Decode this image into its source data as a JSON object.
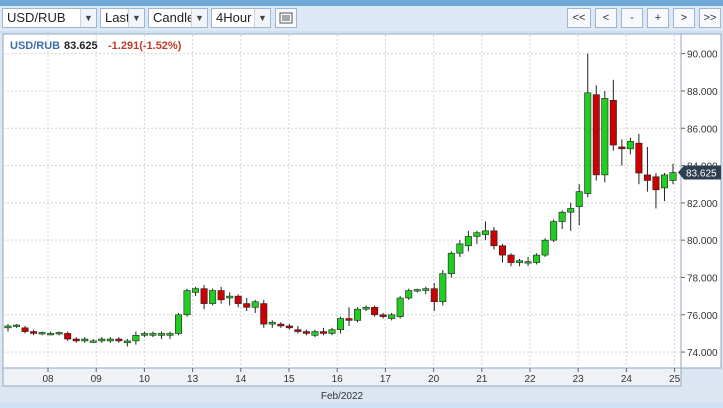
{
  "toolbar": {
    "symbol": "USD/RUB",
    "price_type": "Last",
    "chart_style": "Candle",
    "interval": "4Hour",
    "nav": [
      "<<",
      "<",
      "-",
      "+",
      ">",
      ">>"
    ],
    "list_icon": "list-icon",
    "dropdown_icon": "chevron-down-icon"
  },
  "header": {
    "symbol": "USD/RUB",
    "price": "83.625",
    "change": "-1.291(-1.52%)"
  },
  "colors": {
    "up": "#22cc22",
    "down": "#cc0000",
    "symbol": "#3a6ea5",
    "change": "#c0392b",
    "badge": "#2d3e50"
  },
  "chart_data": {
    "type": "candlestick",
    "x_label": "Feb/2022",
    "x_ticks": [
      "08",
      "09",
      "10",
      "13",
      "14",
      "15",
      "16",
      "17",
      "20",
      "21",
      "22",
      "23",
      "24",
      "25"
    ],
    "y_ticks": [
      "74.000",
      "76.000",
      "78.000",
      "80.000",
      "82.000",
      "84.000",
      "86.000",
      "88.000",
      "90.000"
    ],
    "ylim": [
      73.2,
      91.0
    ],
    "last_price": "83.625",
    "candles": [
      [
        75.3,
        75.5,
        75.1,
        75.4
      ],
      [
        75.4,
        75.5,
        75.3,
        75.45
      ],
      [
        75.3,
        75.4,
        75.0,
        75.1
      ],
      [
        75.1,
        75.2,
        74.9,
        75.0
      ],
      [
        75.0,
        75.1,
        74.9,
        75.05
      ],
      [
        75.0,
        75.1,
        74.9,
        75.0
      ],
      [
        75.0,
        75.1,
        74.9,
        75.05
      ],
      [
        75.0,
        75.1,
        74.6,
        74.7
      ],
      [
        74.7,
        74.8,
        74.5,
        74.6
      ],
      [
        74.6,
        74.8,
        74.5,
        74.7
      ],
      [
        74.6,
        74.7,
        74.5,
        74.6
      ],
      [
        74.6,
        74.8,
        74.5,
        74.7
      ],
      [
        74.6,
        74.8,
        74.5,
        74.7
      ],
      [
        74.7,
        74.8,
        74.5,
        74.6
      ],
      [
        74.5,
        74.7,
        74.3,
        74.6
      ],
      [
        74.6,
        75.1,
        74.4,
        74.9
      ],
      [
        74.9,
        75.1,
        74.8,
        75.0
      ],
      [
        74.9,
        75.1,
        74.8,
        75.0
      ],
      [
        74.9,
        75.1,
        74.7,
        75.0
      ],
      [
        74.9,
        75.1,
        74.7,
        75.0
      ],
      [
        75.0,
        76.1,
        74.9,
        76.0
      ],
      [
        76.0,
        77.4,
        75.9,
        77.3
      ],
      [
        77.2,
        77.5,
        77.0,
        77.4
      ],
      [
        77.4,
        77.6,
        76.3,
        76.6
      ],
      [
        76.6,
        77.4,
        76.5,
        77.3
      ],
      [
        77.3,
        77.5,
        76.6,
        76.8
      ],
      [
        76.9,
        77.2,
        76.5,
        77.0
      ],
      [
        77.0,
        77.1,
        76.4,
        76.6
      ],
      [
        76.6,
        76.9,
        76.2,
        76.4
      ],
      [
        76.4,
        76.8,
        76.1,
        76.7
      ],
      [
        76.6,
        76.8,
        75.3,
        75.5
      ],
      [
        75.5,
        75.7,
        75.3,
        75.6
      ],
      [
        75.5,
        75.6,
        75.3,
        75.4
      ],
      [
        75.4,
        75.5,
        75.2,
        75.3
      ],
      [
        75.2,
        75.4,
        75.0,
        75.1
      ],
      [
        75.1,
        75.2,
        74.9,
        75.0
      ],
      [
        74.9,
        75.2,
        74.8,
        75.1
      ],
      [
        75.1,
        75.3,
        74.9,
        75.0
      ],
      [
        75.0,
        75.3,
        74.9,
        75.2
      ],
      [
        75.2,
        75.9,
        75.0,
        75.8
      ],
      [
        75.8,
        76.4,
        75.4,
        75.7
      ],
      [
        75.7,
        76.4,
        75.6,
        76.3
      ],
      [
        76.3,
        76.5,
        76.2,
        76.4
      ],
      [
        76.4,
        76.5,
        75.9,
        76.0
      ],
      [
        76.0,
        76.1,
        75.8,
        75.9
      ],
      [
        75.8,
        76.1,
        75.7,
        76.0
      ],
      [
        75.9,
        77.0,
        75.8,
        76.9
      ],
      [
        76.9,
        77.4,
        76.8,
        77.3
      ],
      [
        77.3,
        77.4,
        77.2,
        77.35
      ],
      [
        77.3,
        77.5,
        77.1,
        77.4
      ],
      [
        77.4,
        77.7,
        76.2,
        76.7
      ],
      [
        76.7,
        78.4,
        76.5,
        78.2
      ],
      [
        78.2,
        79.4,
        78.0,
        79.3
      ],
      [
        79.3,
        80.0,
        79.1,
        79.8
      ],
      [
        79.7,
        80.5,
        79.4,
        80.2
      ],
      [
        80.2,
        80.5,
        79.8,
        80.4
      ],
      [
        80.3,
        81.0,
        80.0,
        80.5
      ],
      [
        80.5,
        80.7,
        79.5,
        79.7
      ],
      [
        79.7,
        79.8,
        78.8,
        79.2
      ],
      [
        79.2,
        79.3,
        78.6,
        78.8
      ],
      [
        78.8,
        79.0,
        78.6,
        78.9
      ],
      [
        78.8,
        79.1,
        78.6,
        78.85
      ],
      [
        78.8,
        79.3,
        78.7,
        79.2
      ],
      [
        79.2,
        80.1,
        79.1,
        80.0
      ],
      [
        80.0,
        81.1,
        79.9,
        81.0
      ],
      [
        81.0,
        81.6,
        80.6,
        81.5
      ],
      [
        81.5,
        82.0,
        80.5,
        81.7
      ],
      [
        81.8,
        83.0,
        80.8,
        82.6
      ],
      [
        82.5,
        90.0,
        82.3,
        87.9
      ],
      [
        87.8,
        88.3,
        83.2,
        83.5
      ],
      [
        83.5,
        88.0,
        83.1,
        87.6
      ],
      [
        87.5,
        88.6,
        84.8,
        85.1
      ],
      [
        85.0,
        85.4,
        84.0,
        84.9
      ],
      [
        84.9,
        85.5,
        84.6,
        85.3
      ],
      [
        85.2,
        85.7,
        83.0,
        83.6
      ],
      [
        83.5,
        85.0,
        82.6,
        83.2
      ],
      [
        83.4,
        83.6,
        81.7,
        82.7
      ],
      [
        82.8,
        83.6,
        82.1,
        83.5
      ],
      [
        83.2,
        84.1,
        83.0,
        83.625
      ]
    ]
  }
}
